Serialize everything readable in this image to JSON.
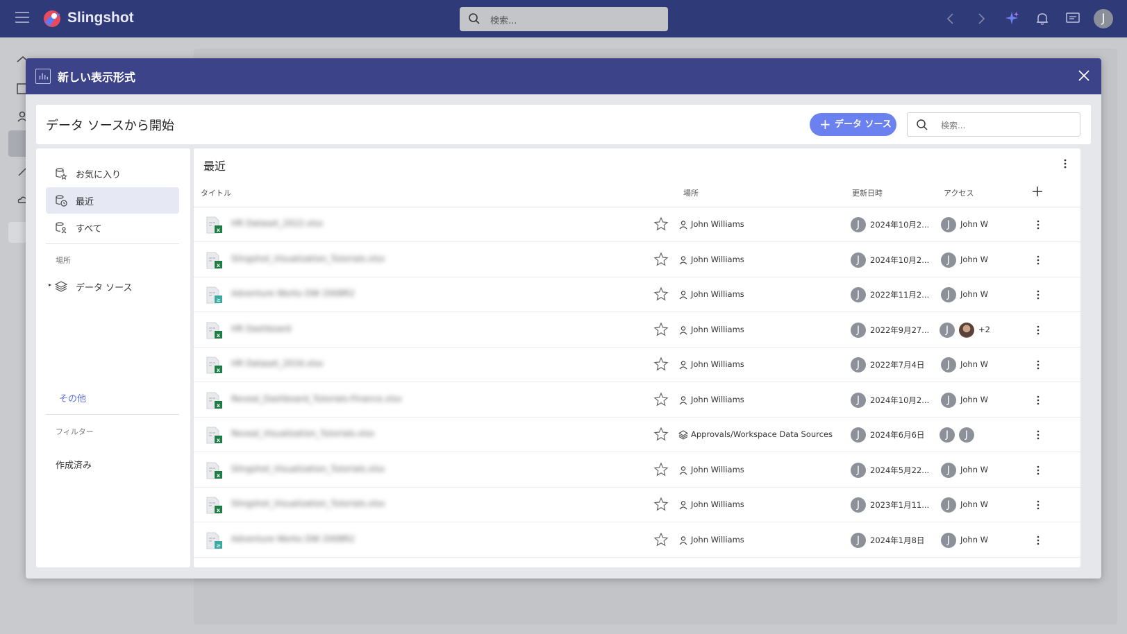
{
  "app": {
    "brand": "Slingshot",
    "search_placeholder": "検索..."
  },
  "modal": {
    "title": "新しい表示形式",
    "start_title": "データ ソースから開始",
    "add_datasource_label": "データ ソース",
    "search_placeholder": "検索..."
  },
  "nav": {
    "favorites": "お気に入り",
    "recent": "最近",
    "all": "すべて",
    "location_header": "場所",
    "datasources": "データ ソース",
    "more": "その他",
    "filter_header": "フィルター",
    "created": "作成済み"
  },
  "list": {
    "title": "最近",
    "columns": {
      "title": "タイトル",
      "location": "場所",
      "updated": "更新日時",
      "access": "アクセス"
    },
    "rows": [
      {
        "name": "HR Dataset_2022.xlsx",
        "type": "xlsx",
        "location": "John Williams",
        "location_icon": "person-icon",
        "updated": "2024年10月2...",
        "updated_by": "J",
        "access": "John W"
      },
      {
        "name": "Slingshot_Visualization_Tutorials.xlsx",
        "type": "xlsx",
        "location": "John Williams",
        "location_icon": "person-icon",
        "updated": "2024年10月2...",
        "updated_by": "J",
        "access": "John W"
      },
      {
        "name": "Adventure Works DW 2008R2",
        "type": "db",
        "location": "John Williams",
        "location_icon": "person-icon",
        "updated": "2022年11月2...",
        "updated_by": "J",
        "access": "John W"
      },
      {
        "name": "HR Dashboard",
        "type": "xlsx",
        "location": "John Williams",
        "location_icon": "person-icon",
        "updated": "2022年9月27...",
        "updated_by": "J",
        "access": "+2"
      },
      {
        "name": "HR Dataset_2016.xlsx",
        "type": "xlsx",
        "location": "John Williams",
        "location_icon": "person-icon",
        "updated": "2022年7月4日",
        "updated_by": "J",
        "access": "John W"
      },
      {
        "name": "Reveal_Dashboard_Tutorials-Finance.xlsx",
        "type": "xlsx",
        "location": "John Williams",
        "location_icon": "person-icon",
        "updated": "2024年10月2...",
        "updated_by": "J",
        "access": "John W"
      },
      {
        "name": "Reveal_Visualization_Tutorials.xlsx",
        "type": "xlsx",
        "location": "Approvals/Workspace Data Sources",
        "location_icon": "layers-icon",
        "updated": "2024年6月6日",
        "updated_by": "J",
        "access": ""
      },
      {
        "name": "Slingshot_Visualization_Tutorials.xlsx",
        "type": "xlsx",
        "location": "John Williams",
        "location_icon": "person-icon",
        "updated": "2024年5月22...",
        "updated_by": "J",
        "access": "John W"
      },
      {
        "name": "Slingshot_Visualization_Tutorials.xlsx",
        "type": "xlsx",
        "location": "John Williams",
        "location_icon": "person-icon",
        "updated": "2023年1月11...",
        "updated_by": "J",
        "access": "John W"
      },
      {
        "name": "Adventure Works DW 2008R2",
        "type": "db",
        "location": "John Williams",
        "location_icon": "person-icon",
        "updated": "2024年1月8日",
        "updated_by": "J",
        "access": "John W"
      }
    ]
  },
  "colors": {
    "topbar": "#2f3a78",
    "modal_header": "#3c4388",
    "accent": "#6b81f0",
    "avatar": "#8c9099"
  }
}
